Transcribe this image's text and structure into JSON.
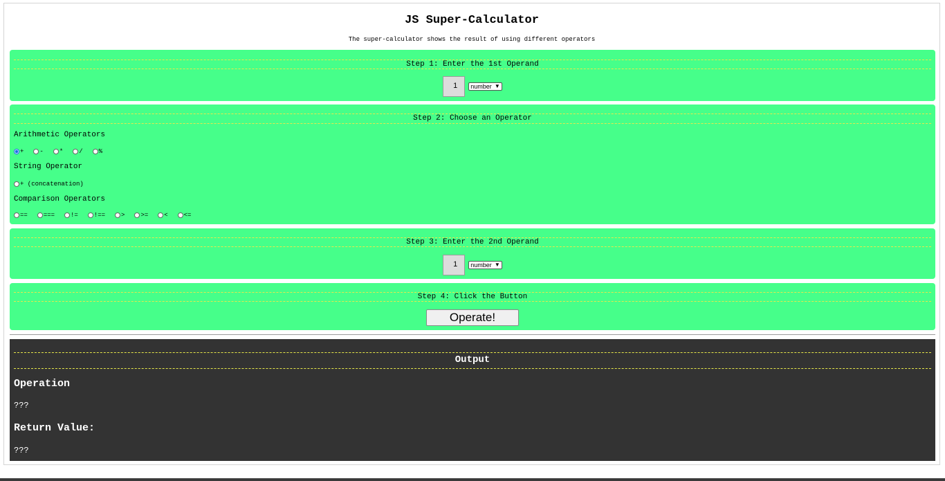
{
  "header": {
    "title": "JS Super-Calculator",
    "subtitle": "The super-calculator shows the result of using different operators"
  },
  "step1": {
    "heading": "Step 1: Enter the 1st Operand",
    "operand_value": "1",
    "type_selected": "number"
  },
  "step2": {
    "heading": "Step 2: Choose an Operator",
    "arithmetic_label": "Arithmetic Operators",
    "arithmetic_ops": [
      "+",
      "-",
      "*",
      "/",
      "%"
    ],
    "arithmetic_selected": "+",
    "string_label": "String Operator",
    "string_ops": [
      "+ (concatenation)"
    ],
    "comparison_label": "Comparison Operators",
    "comparison_ops": [
      "==",
      "===",
      "!=",
      "!==",
      ">",
      ">=",
      "<",
      "<="
    ]
  },
  "step3": {
    "heading": "Step 3: Enter the 2nd Operand",
    "operand_value": "1",
    "type_selected": "number"
  },
  "step4": {
    "heading": "Step 4: Click the Button",
    "button_label": "Operate!"
  },
  "output": {
    "heading": "Output",
    "operation_label": "Operation",
    "operation_value": "???",
    "return_label": "Return Value:",
    "return_value": "???"
  },
  "colors": {
    "panel": "#46ff8a",
    "output_bg": "#333333",
    "dash": "#e8e84a",
    "radio_checked": "#1a6fe6"
  }
}
